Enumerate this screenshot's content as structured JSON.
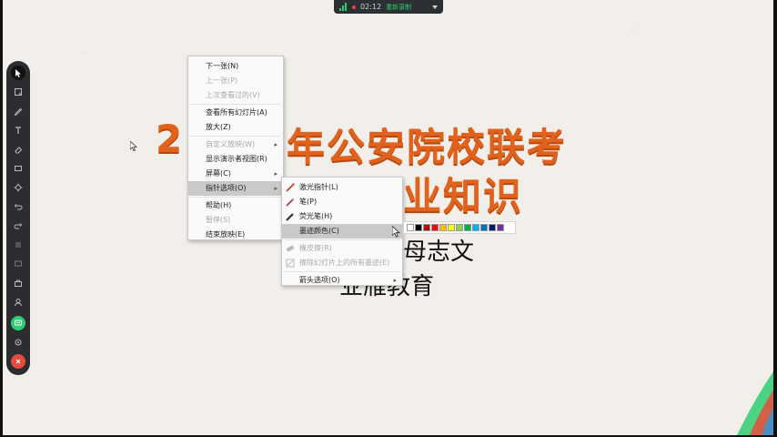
{
  "recording": {
    "time": "02:12",
    "rerecord_label": "重新录制",
    "colors": {
      "signal": "#2ecc71",
      "rec_dot": "#e74c3c",
      "bar": "#2c2f33"
    }
  },
  "toolbar": {
    "tools": [
      {
        "name": "select-pointer-icon"
      },
      {
        "name": "select-rect-icon"
      },
      {
        "name": "pen-icon"
      },
      {
        "name": "text-icon"
      },
      {
        "name": "eraser-icon"
      },
      {
        "name": "rectangle-icon"
      },
      {
        "name": "laser-icon"
      },
      {
        "name": "undo-icon"
      },
      {
        "name": "redo-icon"
      },
      {
        "name": "blank-icon"
      },
      {
        "name": "screen-icon"
      },
      {
        "name": "briefcase-icon"
      },
      {
        "name": "user-icon"
      },
      {
        "name": "chat-icon"
      },
      {
        "name": "settings-icon"
      },
      {
        "name": "close-icon"
      }
    ],
    "close_color": "#e74c3c",
    "active_color": "#2ecc71"
  },
  "slide": {
    "title_line1_a": "2",
    "title_line1_b": "年公安院校联考",
    "title_line2_b": "业知识",
    "teacher_suffix": "母志文",
    "org_suffix": "业雁教育",
    "title_color": "#e0621c"
  },
  "context_menu": {
    "items": [
      {
        "label": "下一张(N)",
        "disabled": false
      },
      {
        "label": "上一张(P)",
        "disabled": true
      },
      {
        "label": "上次查看过的(V)",
        "disabled": true
      },
      {
        "label": "查看所有幻灯片(A)",
        "disabled": false
      },
      {
        "label": "放大(Z)",
        "disabled": false
      },
      {
        "label": "自定义放映(W)",
        "disabled": true,
        "submenu": true
      },
      {
        "label": "显示演示者视图(R)",
        "disabled": false
      },
      {
        "label": "屏幕(C)",
        "disabled": false,
        "submenu": true
      },
      {
        "label": "指针选项(O)",
        "disabled": false,
        "submenu": true,
        "highlighted": true
      },
      {
        "label": "帮助(H)",
        "disabled": false
      },
      {
        "label": "暂停(S)",
        "disabled": true
      },
      {
        "label": "结束放映(E)",
        "disabled": false
      }
    ]
  },
  "pointer_submenu": {
    "items": [
      {
        "label": "激光指针(L)",
        "icon": "laser-pointer-icon"
      },
      {
        "label": "笔(P)",
        "icon": "pen-icon"
      },
      {
        "label": "荧光笔(H)",
        "icon": "highlighter-icon"
      },
      {
        "label": "墨迹颜色(C)",
        "highlighted": true,
        "submenu": true
      },
      {
        "label": "橡皮擦(R)",
        "disabled": true,
        "icon": "eraser-icon"
      },
      {
        "label": "擦除幻灯片上的所有墨迹(E)",
        "disabled": true,
        "icon": "erase-all-icon"
      },
      {
        "label": "箭头选项(O)",
        "submenu": true
      }
    ]
  },
  "ink_colors": [
    "#ffffff",
    "#000000",
    "#c00000",
    "#ff0000",
    "#ffc000",
    "#ffff00",
    "#92d050",
    "#00b050",
    "#00b0f0",
    "#0070c0",
    "#002060",
    "#7030a0"
  ]
}
